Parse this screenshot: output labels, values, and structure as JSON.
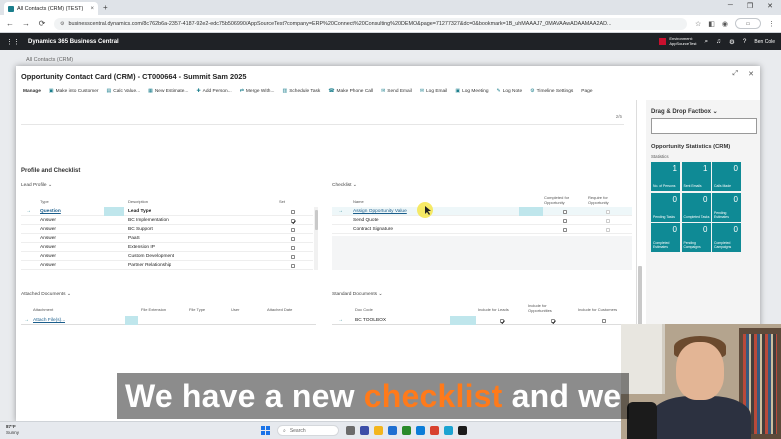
{
  "browser": {
    "tab_title": "All Contacts (CRM) (TEST)",
    "tab_close": "×",
    "new_tab": "+",
    "url": "businesscentral.dynamics.com/8c762b6a-2357-4187-92e2-edc75b506990/AppSourceTest?company=ERP%20Connect%20Consulting%20DEMO&page=71277327&dc=0&bookmark=1B_uhMAAAJ7_0MAVAAwADAAMAA2AD...",
    "back": "←",
    "forward": "→",
    "reload": "⟳",
    "window_controls": [
      "─",
      "❐",
      "✕"
    ]
  },
  "bc": {
    "app_name": "Dynamics 365 Business Central",
    "environment": [
      "Environment:",
      "AppSourceTest"
    ],
    "user": "Ben Cole"
  },
  "background": {
    "breadcrumb": "All Contacts (CRM)"
  },
  "card": {
    "title": "Opportunity Contact Card (CRM) - CT000664 - Summit Sam 2025",
    "actions": [
      "Manage",
      "Make into Customer",
      "Calc Value...",
      "New Estimate...",
      "Add Person...",
      "Merge With...",
      "Schedule Task",
      "Make Phone Call",
      "Send Email",
      "Log Email",
      "Log Meeting",
      "Log Note",
      "Timeline Settings",
      "Page"
    ],
    "notes_count": "2/5",
    "profile_section": "Profile and Checklist",
    "lead_profile": {
      "title": "Lead Profile",
      "headers": [
        "Type",
        "Description",
        "Set"
      ],
      "rows": [
        {
          "type": "Question",
          "description": "Lead Type",
          "set": false
        },
        {
          "type": "Answer",
          "description": "BC Implementation",
          "set": true
        },
        {
          "type": "Answer",
          "description": "BC Support",
          "set": false
        },
        {
          "type": "Answer",
          "description": "PaaS",
          "set": false
        },
        {
          "type": "Answer",
          "description": "Extension IP",
          "set": false
        },
        {
          "type": "Answer",
          "description": "Custom Development",
          "set": false
        },
        {
          "type": "Answer",
          "description": "Partner Relationship",
          "set": false
        }
      ]
    },
    "checklist": {
      "title": "Checklist",
      "headers": [
        "Name",
        "Completed for Opportunity",
        "Require for Opportunity"
      ],
      "rows": [
        {
          "name": "Assign Opportunity Value"
        },
        {
          "name": "Send Quote"
        },
        {
          "name": "Contract Signature"
        }
      ]
    },
    "attached_documents": {
      "title": "Attached Documents",
      "headers": [
        "Attachment",
        "File Extension",
        "File Type",
        "User",
        "Attached Date"
      ],
      "rows": [
        {
          "attachment": "Attach File(s)..."
        }
      ]
    },
    "standard_documents": {
      "title": "Standard Documents",
      "headers": [
        "Doc Code",
        "Include for Leads",
        "Include for Opportunities",
        "Include for Customers"
      ],
      "rows": [
        {
          "doc_code": "BC TOOLBOX"
        }
      ]
    }
  },
  "factbox": {
    "dragdrop_title": "Drag & Drop Factbox",
    "stats_title": "Opportunity Statistics (CRM)",
    "stats_sub": "Statistics",
    "tiles": [
      {
        "value": "1",
        "label": "No. of Persons"
      },
      {
        "value": "1",
        "label": "Sent Emails"
      },
      {
        "value": "0",
        "label": "Calls Made"
      },
      {
        "value": "0",
        "label": "Pending Tasks"
      },
      {
        "value": "0",
        "label": "Completed Tasks"
      },
      {
        "value": "0",
        "label": "Pending Estimates"
      },
      {
        "value": "0",
        "label": "Completed Estimates"
      },
      {
        "value": "0",
        "label": "Pending Campaigns"
      },
      {
        "value": "0",
        "label": "Completed Campaigns"
      }
    ]
  },
  "subtitle": {
    "before": "We have a new ",
    "highlight": "checklist",
    "after": " and we"
  },
  "taskbar": {
    "temp": "87°F",
    "condition": "Sunny",
    "search": "Search"
  },
  "colors": {
    "accent": "#0f8a95",
    "highlight": "#ff7a1a",
    "appbar": "#1f2226"
  }
}
